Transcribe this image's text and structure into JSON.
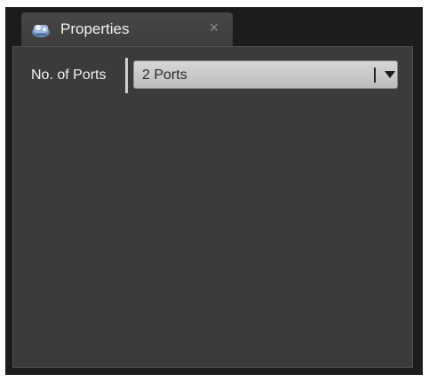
{
  "tab": {
    "title": "Properties",
    "close_glyph": "×",
    "icon": "properties-panel-icon"
  },
  "properties": {
    "ports_label": "No. of Ports",
    "ports_value": "2 Ports",
    "dropdown_icon": "chevron-down-icon"
  },
  "colors": {
    "panel_background": "#3b3b3b",
    "tab_background": "#474747",
    "dropdown_background": "#d6d6d6",
    "label_text": "#f2f2f2"
  }
}
